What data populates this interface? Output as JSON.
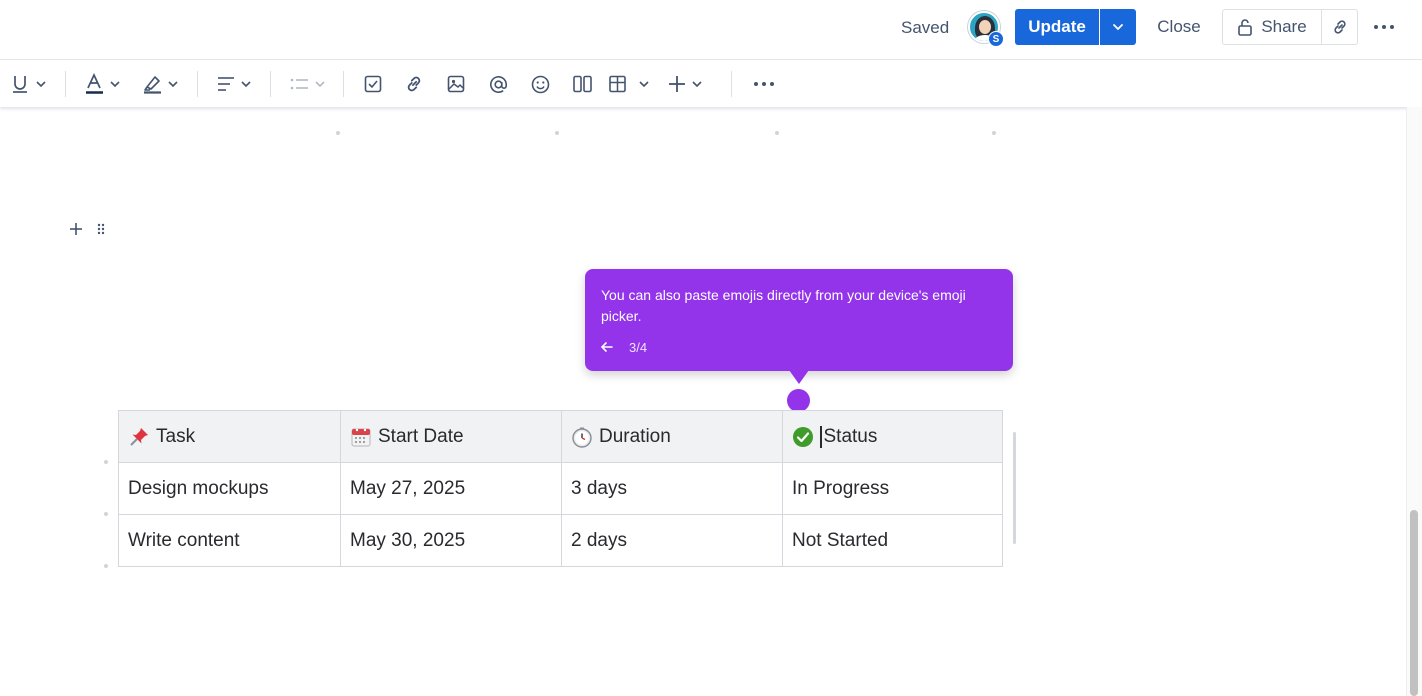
{
  "header": {
    "saved_status": "Saved",
    "avatar_badge": "S",
    "update_label": "Update",
    "close_label": "Close",
    "share_label": "Share"
  },
  "toolbar": {
    "items": [
      "underline-icon",
      "text-color-icon",
      "highlight-icon",
      "align-icon",
      "list-icon",
      "action-item-icon",
      "link-icon",
      "image-icon",
      "mention-icon",
      "emoji-icon",
      "layout-icon",
      "table-icon",
      "insert-icon",
      "more-icon"
    ]
  },
  "tooltip": {
    "message": "You can also paste emojis directly from your device's emoji picker.",
    "step": "3/4"
  },
  "table": {
    "headers": [
      {
        "icon": "pushpin-icon",
        "label": "Task"
      },
      {
        "icon": "calendar-icon",
        "label": "Start Date"
      },
      {
        "icon": "clock-icon",
        "label": "Duration"
      },
      {
        "icon": "check-mark-icon",
        "label": "Status"
      }
    ],
    "rows": [
      [
        "Design mockups",
        "May 27, 2025",
        "3 days",
        "In Progress"
      ],
      [
        "Write content",
        "May 30, 2025",
        "2 days",
        "Not Started"
      ]
    ]
  },
  "colors": {
    "primary": "#1868db",
    "tooltip": "#9333ea",
    "status_green": "#3f9b2a"
  }
}
